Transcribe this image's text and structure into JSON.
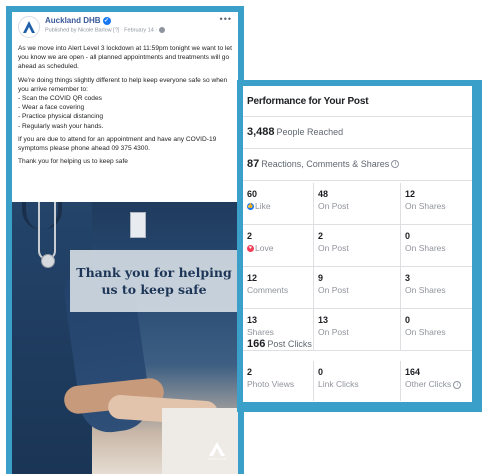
{
  "post": {
    "page_name": "Auckland DHB",
    "meta": "Published by Nicole Barlow [?] · February 14 ·",
    "paragraphs": [
      "As we move into Alert Level 3 lockdown at 11:59pm tonight we want to let you know we are open - all planned appointments and treatments will go ahead as scheduled.",
      "We're doing things slightly different to help keep everyone safe so when you arrive remember to:",
      "If you are due to attend for an appointment and have any COVID-19 symptoms please phone ahead 09 375 4300.",
      "Thank you for helping us to keep safe"
    ],
    "list": [
      "- Scan the COVID QR codes",
      "- Wear a face covering",
      "- Practice physical distancing",
      "- Regularly wash your hands."
    ],
    "image_overlay": [
      "Thank you for helping",
      "us to keep safe"
    ],
    "brand_text": "AUCKLAND"
  },
  "performance": {
    "title": "Performance for Your Post",
    "reach_value": "3,488",
    "reach_label": "People Reached",
    "reactions_value": "87",
    "reactions_label": "Reactions, Comments & Shares",
    "rows": [
      [
        {
          "value": "60",
          "label": "Like"
        },
        {
          "value": "48",
          "label": "On Post"
        },
        {
          "value": "12",
          "label": "On Shares"
        }
      ],
      [
        {
          "value": "2",
          "label": "Love"
        },
        {
          "value": "2",
          "label": "On Post"
        },
        {
          "value": "0",
          "label": "On Shares"
        }
      ],
      [
        {
          "value": "12",
          "label": "Comments"
        },
        {
          "value": "9",
          "label": "On Post"
        },
        {
          "value": "3",
          "label": "On Shares"
        }
      ],
      [
        {
          "value": "13",
          "label": "Shares"
        },
        {
          "value": "13",
          "label": "On Post"
        },
        {
          "value": "0",
          "label": "On Shares"
        }
      ]
    ],
    "clicks_value": "166",
    "clicks_label": "Post Clicks",
    "click_rows": [
      {
        "value": "2",
        "label": "Photo Views"
      },
      {
        "value": "0",
        "label": "Link Clicks"
      },
      {
        "value": "164",
        "label": "Other Clicks"
      }
    ]
  },
  "colors": {
    "frame": "#3a9fc9",
    "link_blue": "#385898",
    "navy_text": "#1d3557"
  }
}
